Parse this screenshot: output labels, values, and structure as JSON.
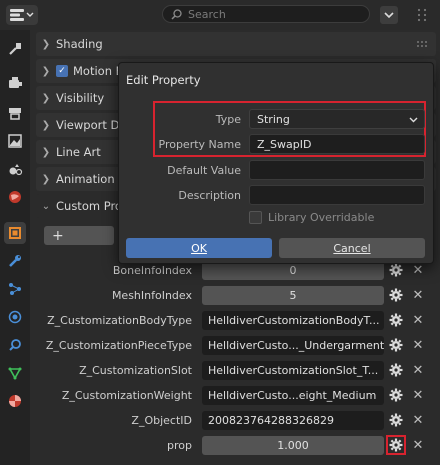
{
  "header": {
    "search_placeholder": "Search",
    "editor_type_icon": "properties-editor-icon",
    "filter_icon": "filter-chevron-icon"
  },
  "sidebar": {
    "items": [
      {
        "icon": "tool-icon",
        "active": false
      },
      {
        "icon": "render-icon",
        "active": false
      },
      {
        "icon": "output-icon",
        "active": false
      },
      {
        "icon": "view-layer-icon",
        "active": false
      },
      {
        "icon": "scene-icon",
        "active": false
      },
      {
        "icon": "world-icon",
        "active": false
      },
      {
        "icon": "object-icon",
        "active": true
      },
      {
        "icon": "modifier-wrench-icon",
        "active": false
      },
      {
        "icon": "particles-icon",
        "active": false
      },
      {
        "icon": "physics-icon",
        "active": false
      },
      {
        "icon": "constraints-icon",
        "active": false
      },
      {
        "icon": "data-icon",
        "active": false
      },
      {
        "icon": "material-icon",
        "active": false
      }
    ]
  },
  "panels": {
    "shading": "Shading",
    "motion_blur": "Motion E",
    "visibility": "Visibility",
    "viewport_display": "Viewport Di",
    "line_art": "Line Art",
    "animation": "Animation",
    "custom_properties": "Custom Pro"
  },
  "custom_props": {
    "add_label": "+",
    "rows": [
      {
        "label": "BoneInfoIndex",
        "value": "0",
        "kind": "num",
        "highlight": false
      },
      {
        "label": "MeshInfoIndex",
        "value": "5",
        "kind": "num",
        "highlight": false
      },
      {
        "label": "Z_CustomizationBodyType",
        "value": "HelldiverCustomizationBodyT...",
        "kind": "text",
        "highlight": false
      },
      {
        "label": "Z_CustomizationPieceType",
        "value": "HelldiverCusto..._Undergarment",
        "kind": "text",
        "highlight": false
      },
      {
        "label": "Z_CustomizationSlot",
        "value": "HelldiverCustomizationSlot_T...",
        "kind": "text",
        "highlight": false
      },
      {
        "label": "Z_CustomizationWeight",
        "value": "HelldiverCusto...eight_Medium",
        "kind": "text",
        "highlight": false
      },
      {
        "label": "Z_ObjectID",
        "value": "200823764288326829",
        "kind": "text",
        "highlight": false
      },
      {
        "label": "prop",
        "value": "1.000",
        "kind": "num",
        "highlight": true
      }
    ]
  },
  "dialog": {
    "title": "Edit Property",
    "type_label": "Type",
    "type_value": "String",
    "name_label": "Property Name",
    "name_value": "Z_SwapID",
    "default_label": "Default Value",
    "default_value": "",
    "description_label": "Description",
    "description_value": "",
    "overridable_label": "Library Overridable",
    "ok_label": "OK",
    "cancel_label": "Cancel"
  },
  "colors": {
    "accent": "#4772b3",
    "highlight": "#d7232f"
  }
}
